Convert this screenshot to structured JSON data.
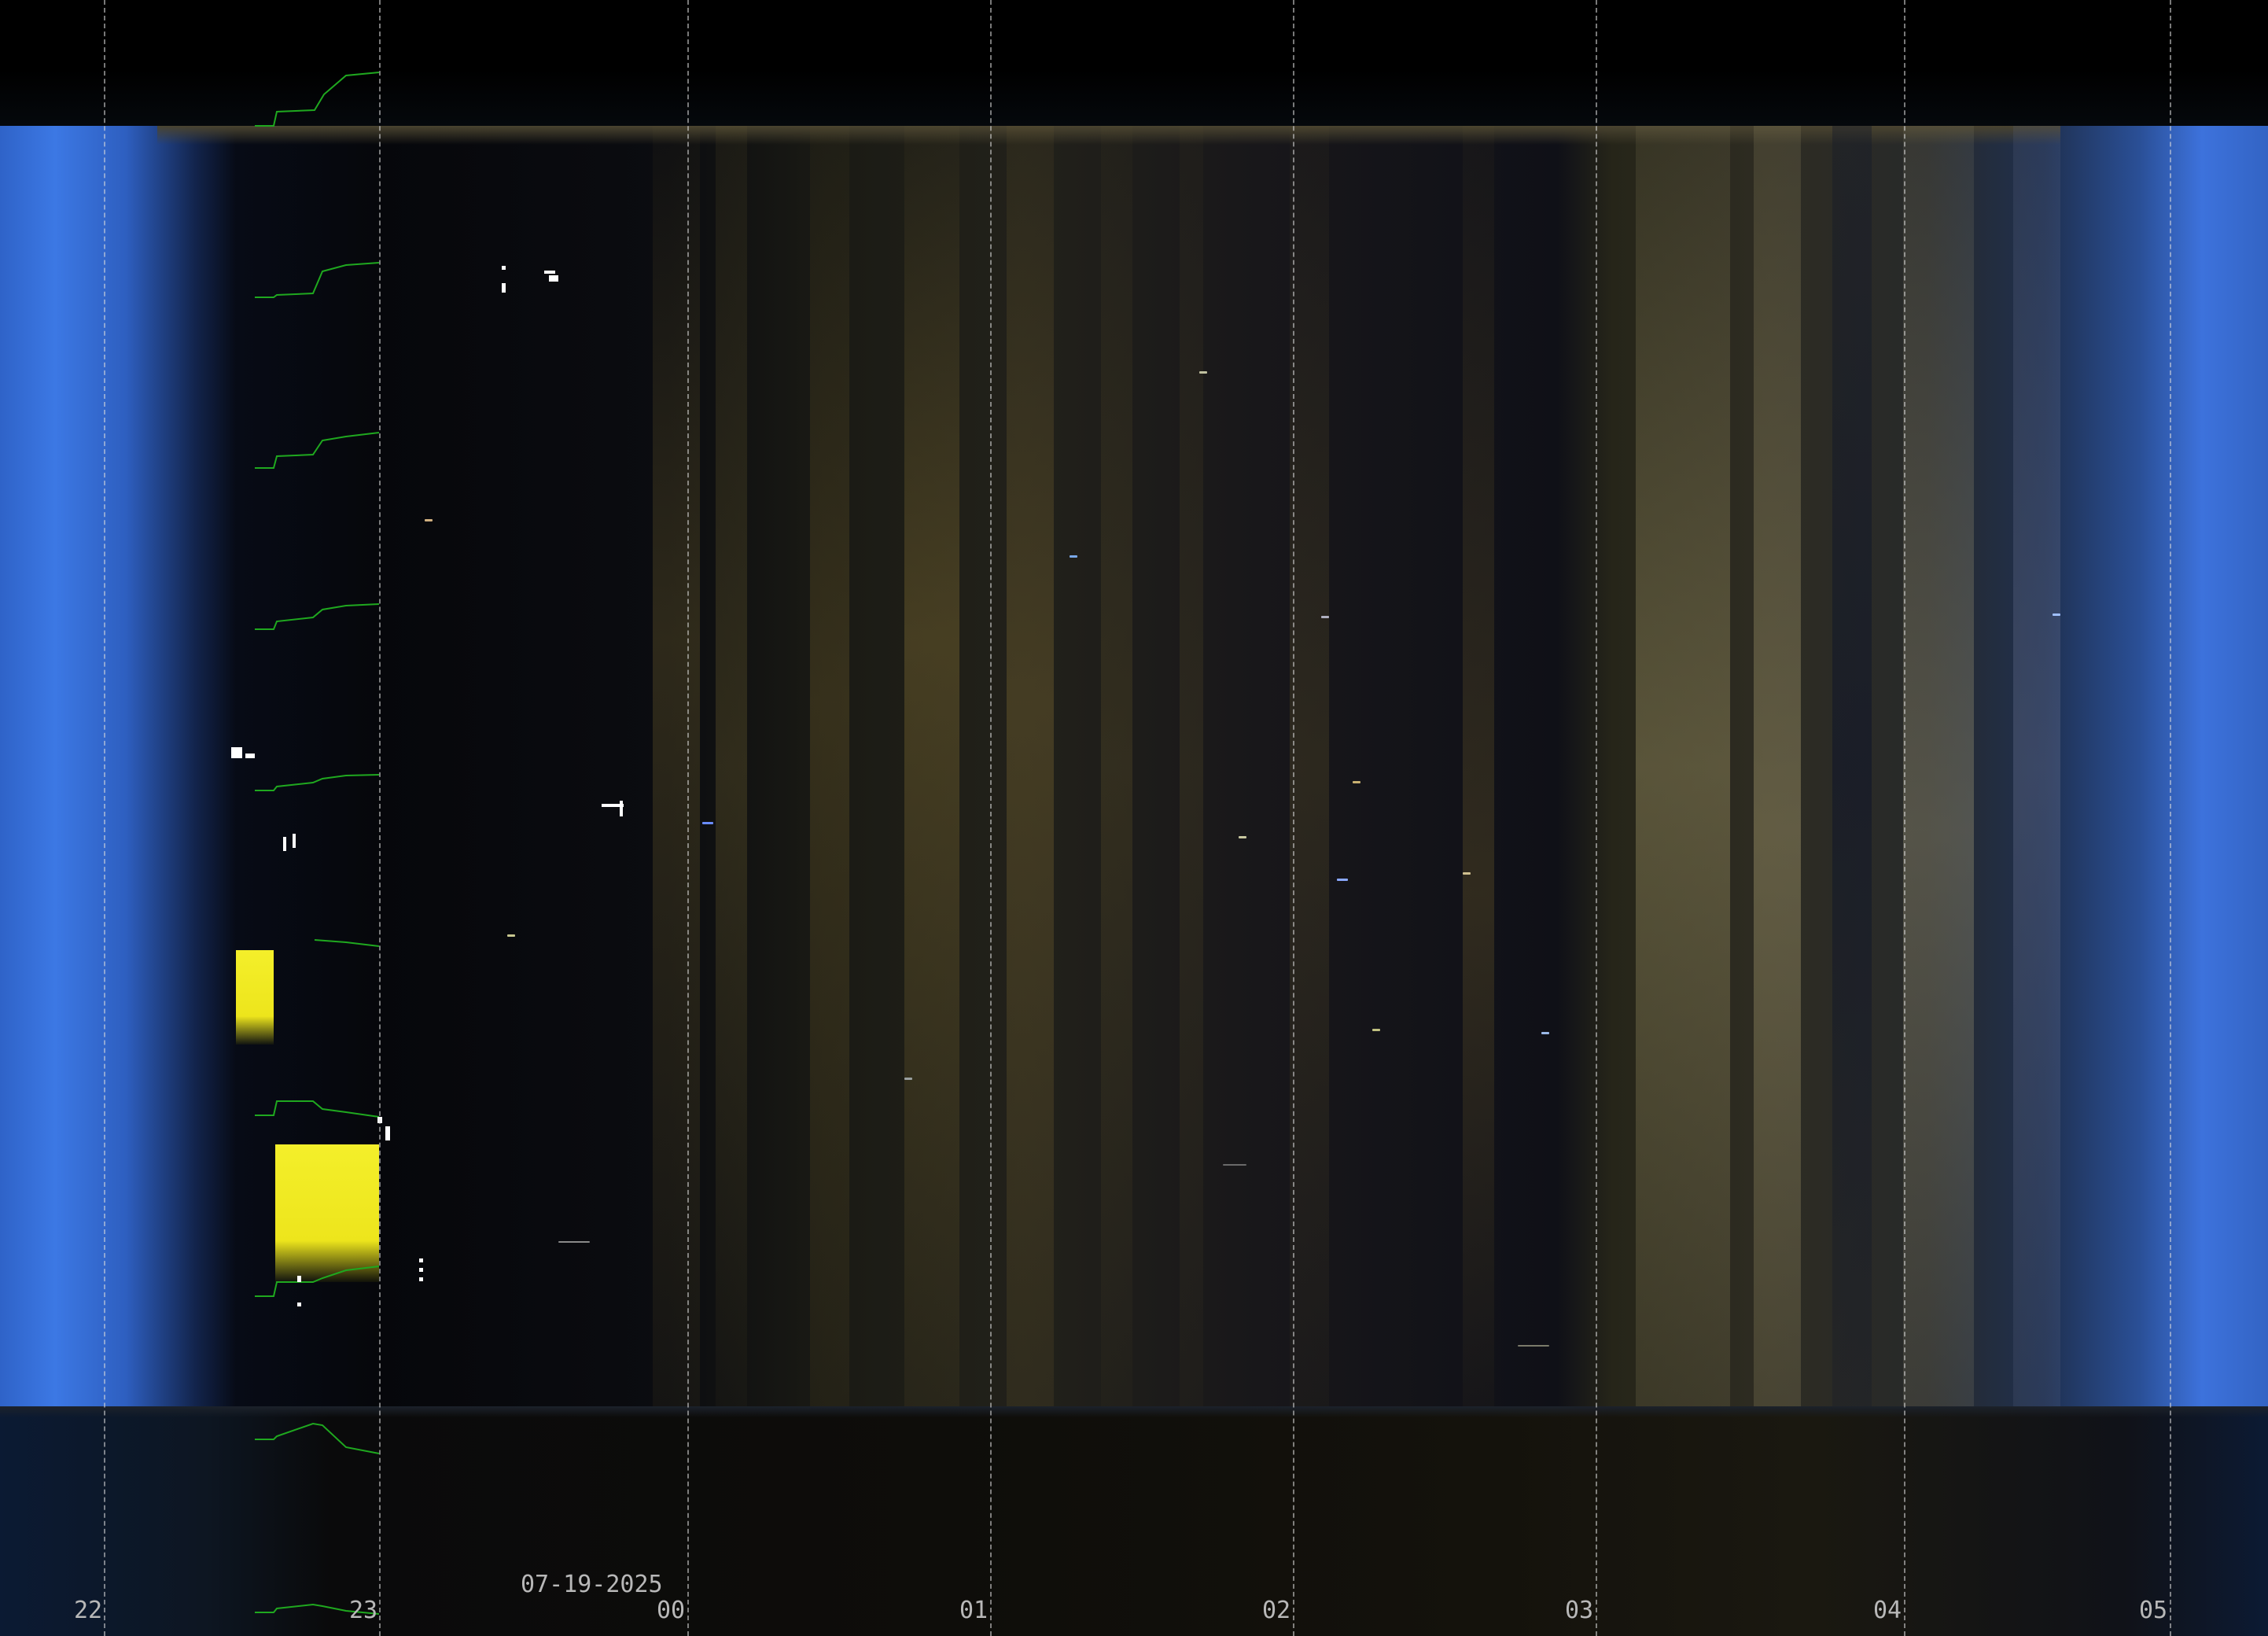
{
  "image": {
    "type": "keogram",
    "date_label": "07-19-2025",
    "hour_ticks": [
      "22",
      "23",
      "00",
      "01",
      "02",
      "03",
      "04",
      "05"
    ],
    "colors": {
      "twilight_blue": "#3c78e4",
      "night_dark": "#06070b",
      "aurora_olive": "#2e2c22",
      "grid": "#dcdcdc",
      "label": "#b8b8b8",
      "trace_green": "#1fa81f",
      "saturated_yellow": "#f4ef2a"
    }
  }
}
